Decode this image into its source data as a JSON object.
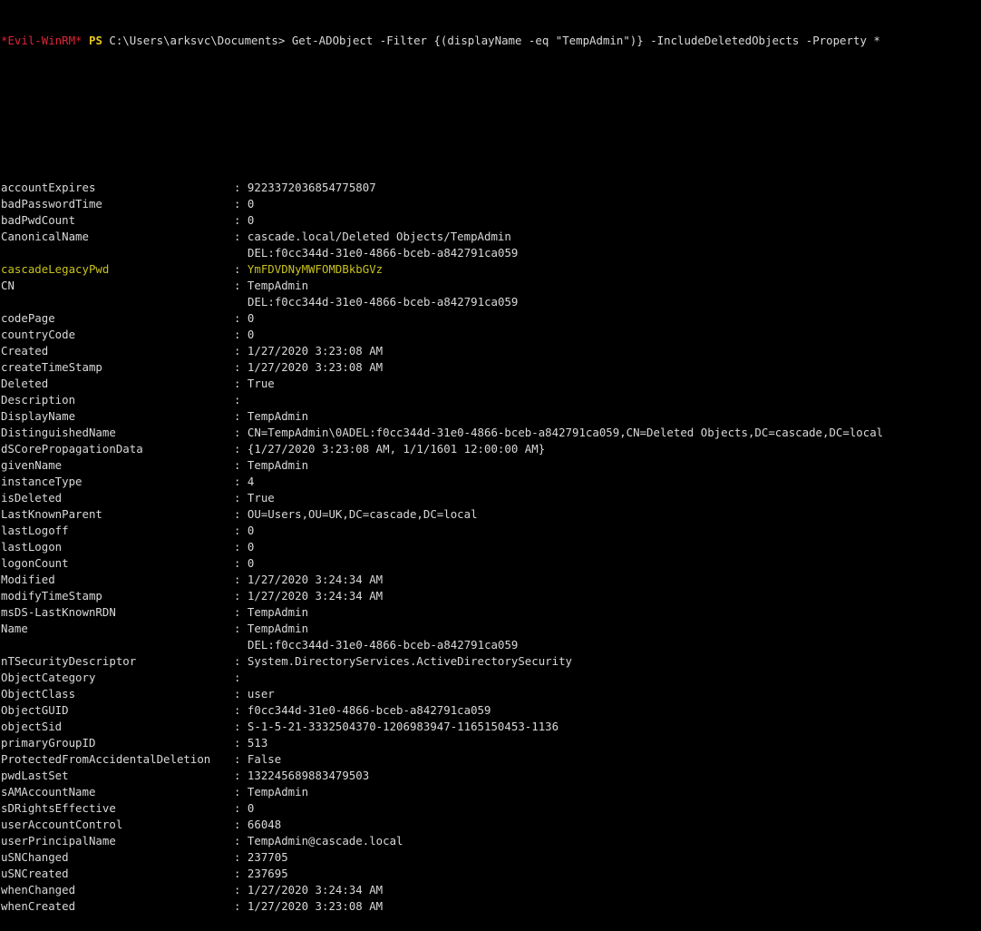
{
  "prompt": {
    "shell_name": "*Evil-WinRM*",
    "ps_label": "PS",
    "location": "C:\\Users\\arksvc\\Documents>",
    "command": " Get-ADObject -Filter {(displayName -eq \"TempAdmin\")} -IncludeDeletedObjects -Property *"
  },
  "colors": {
    "shell_name": "#e0243a",
    "ps_label": "#e6c81a",
    "highlight": "#c9c21e",
    "text": "#d9d9d9",
    "background": "#000000"
  },
  "properties": [
    {
      "key": "accountExpires",
      "value": "9223372036854775807"
    },
    {
      "key": "badPasswordTime",
      "value": "0"
    },
    {
      "key": "badPwdCount",
      "value": "0"
    },
    {
      "key": "CanonicalName",
      "value": "cascade.local/Deleted Objects/TempAdmin",
      "cont": "DEL:f0cc344d-31e0-4866-bceb-a842791ca059"
    },
    {
      "key": "cascadeLegacyPwd",
      "value": "YmFDVDNyMWFOMDBkbGVz",
      "highlight": true
    },
    {
      "key": "CN",
      "value": "TempAdmin",
      "cont": "DEL:f0cc344d-31e0-4866-bceb-a842791ca059"
    },
    {
      "key": "codePage",
      "value": "0"
    },
    {
      "key": "countryCode",
      "value": "0"
    },
    {
      "key": "Created",
      "value": "1/27/2020 3:23:08 AM"
    },
    {
      "key": "createTimeStamp",
      "value": "1/27/2020 3:23:08 AM"
    },
    {
      "key": "Deleted",
      "value": "True"
    },
    {
      "key": "Description",
      "value": ""
    },
    {
      "key": "DisplayName",
      "value": "TempAdmin"
    },
    {
      "key": "DistinguishedName",
      "value": "CN=TempAdmin\\0ADEL:f0cc344d-31e0-4866-bceb-a842791ca059,CN=Deleted Objects,DC=cascade,DC=local"
    },
    {
      "key": "dSCorePropagationData",
      "value": "{1/27/2020 3:23:08 AM, 1/1/1601 12:00:00 AM}"
    },
    {
      "key": "givenName",
      "value": "TempAdmin"
    },
    {
      "key": "instanceType",
      "value": "4"
    },
    {
      "key": "isDeleted",
      "value": "True"
    },
    {
      "key": "LastKnownParent",
      "value": "OU=Users,OU=UK,DC=cascade,DC=local"
    },
    {
      "key": "lastLogoff",
      "value": "0"
    },
    {
      "key": "lastLogon",
      "value": "0"
    },
    {
      "key": "logonCount",
      "value": "0"
    },
    {
      "key": "Modified",
      "value": "1/27/2020 3:24:34 AM"
    },
    {
      "key": "modifyTimeStamp",
      "value": "1/27/2020 3:24:34 AM"
    },
    {
      "key": "msDS-LastKnownRDN",
      "value": "TempAdmin"
    },
    {
      "key": "Name",
      "value": "TempAdmin",
      "cont": "DEL:f0cc344d-31e0-4866-bceb-a842791ca059"
    },
    {
      "key": "nTSecurityDescriptor",
      "value": "System.DirectoryServices.ActiveDirectorySecurity"
    },
    {
      "key": "ObjectCategory",
      "value": ""
    },
    {
      "key": "ObjectClass",
      "value": "user"
    },
    {
      "key": "ObjectGUID",
      "value": "f0cc344d-31e0-4866-bceb-a842791ca059"
    },
    {
      "key": "objectSid",
      "value": "S-1-5-21-3332504370-1206983947-1165150453-1136"
    },
    {
      "key": "primaryGroupID",
      "value": "513"
    },
    {
      "key": "ProtectedFromAccidentalDeletion",
      "value": "False"
    },
    {
      "key": "pwdLastSet",
      "value": "132245689883479503"
    },
    {
      "key": "sAMAccountName",
      "value": "TempAdmin"
    },
    {
      "key": "sDRightsEffective",
      "value": "0"
    },
    {
      "key": "userAccountControl",
      "value": "66048"
    },
    {
      "key": "userPrincipalName",
      "value": "TempAdmin@cascade.local"
    },
    {
      "key": "uSNChanged",
      "value": "237705"
    },
    {
      "key": "uSNCreated",
      "value": "237695"
    },
    {
      "key": "whenChanged",
      "value": "1/27/2020 3:24:34 AM"
    },
    {
      "key": "whenCreated",
      "value": "1/27/2020 3:23:08 AM"
    }
  ]
}
